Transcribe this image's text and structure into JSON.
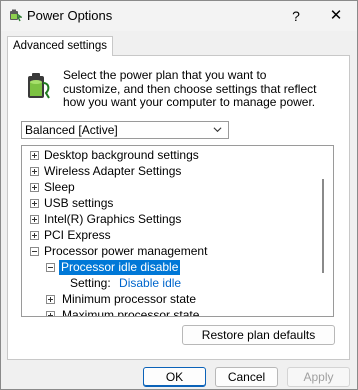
{
  "window": {
    "title": "Power Options",
    "help_glyph": "?",
    "close_glyph": "✕"
  },
  "tab": {
    "label": "Advanced settings"
  },
  "intro_text": "Select the power plan that you want to customize, and then choose settings that reflect how you want your computer to manage power.",
  "plan": {
    "selected": "Balanced [Active]"
  },
  "tree": {
    "items": [
      {
        "label": "Desktop background settings",
        "expander": "plus"
      },
      {
        "label": "Wireless Adapter Settings",
        "expander": "plus"
      },
      {
        "label": "Sleep",
        "expander": "plus"
      },
      {
        "label": "USB settings",
        "expander": "plus"
      },
      {
        "label": "Intel(R) Graphics Settings",
        "expander": "plus"
      },
      {
        "label": "PCI Express",
        "expander": "plus"
      },
      {
        "label": "Processor power management",
        "expander": "minus"
      },
      {
        "label": "Processor idle disable",
        "expander": "minus",
        "selected": true
      },
      {
        "label": "Setting:",
        "value": "Disable idle"
      },
      {
        "label": "Minimum processor state",
        "expander": "plus"
      },
      {
        "label": "Maximum processor state",
        "expander": "plus"
      }
    ]
  },
  "buttons": {
    "restore": "Restore plan defaults",
    "ok": "OK",
    "cancel": "Cancel",
    "apply": "Apply"
  },
  "colors": {
    "selection": "#0078d7",
    "link": "#0066cc",
    "ok_border": "#0b62b8"
  }
}
